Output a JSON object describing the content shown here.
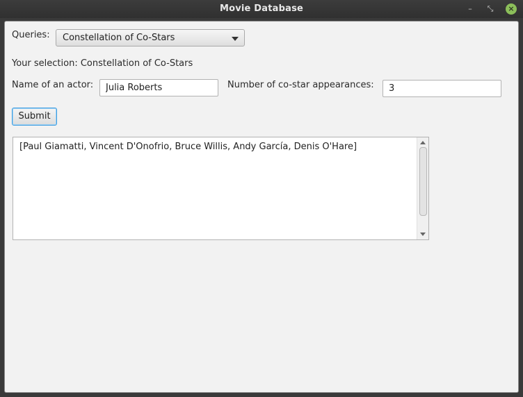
{
  "window": {
    "title": "Movie Database",
    "minimize_symbol": "–",
    "maximize_symbol": "⤡",
    "close_symbol": "×"
  },
  "queries": {
    "label": "Queries:",
    "selected": "Constellation of Co-Stars"
  },
  "selection": {
    "text": "Your selection: Constellation of Co-Stars"
  },
  "actor": {
    "label": "Name of an actor:",
    "value": "Julia Roberts"
  },
  "appearances": {
    "label": "Number of co-star appearances:",
    "value": "3"
  },
  "submit": {
    "label": "Submit"
  },
  "result": {
    "text": "[Paul Giamatti, Vincent D'Onofrio, Bruce Willis, Andy García, Denis O'Hare]"
  },
  "icons": {
    "minimize": "minimize-icon",
    "maximize": "maximize-icon",
    "close": "close-icon",
    "dropdown": "chevron-down-icon"
  },
  "colors": {
    "focus_accent": "#3f9ee0",
    "close_button": "#8cbf5a"
  }
}
